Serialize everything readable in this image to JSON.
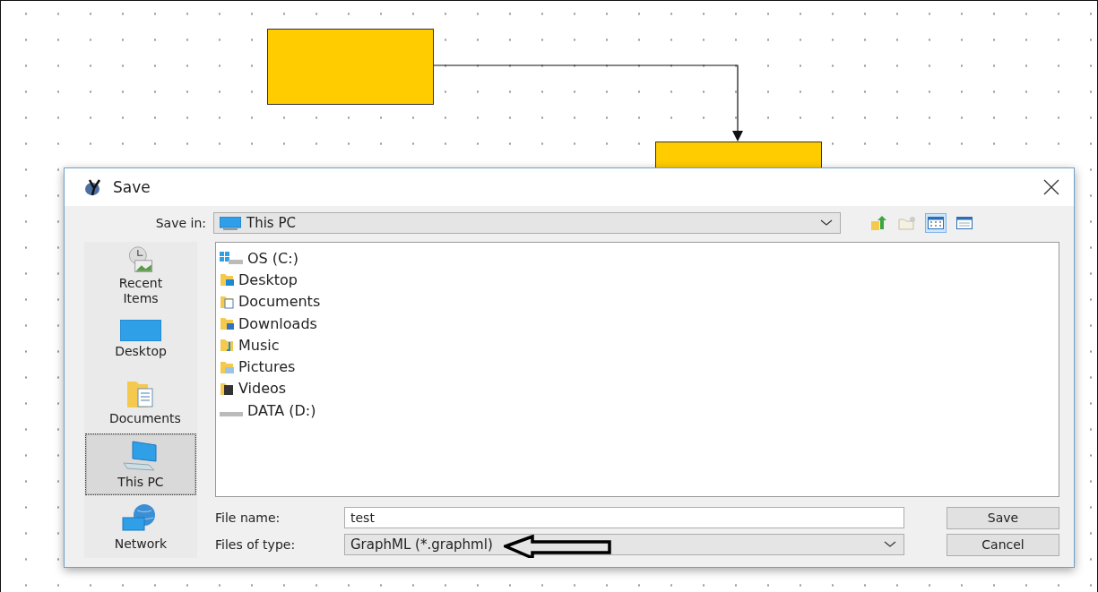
{
  "dialog": {
    "title": "Save",
    "save_in": {
      "label": "Save in:",
      "value": "This PC"
    },
    "view_buttons": [
      {
        "kind": "list",
        "selected": true
      },
      {
        "kind": "details",
        "selected": false
      }
    ],
    "places": [
      {
        "label": "Recent Items",
        "kind": "recent",
        "selected": false
      },
      {
        "label": "Desktop",
        "kind": "desktop",
        "selected": false
      },
      {
        "label": "Documents",
        "kind": "documents",
        "selected": false
      },
      {
        "label": "This PC",
        "kind": "pc",
        "selected": true
      },
      {
        "label": "Network",
        "kind": "network",
        "selected": false
      }
    ],
    "files": [
      {
        "name": "OS (C:)",
        "kind": "drive"
      },
      {
        "name": "Desktop",
        "kind": "desktop"
      },
      {
        "name": "Documents",
        "kind": "documents"
      },
      {
        "name": "Downloads",
        "kind": "downloads"
      },
      {
        "name": "Music",
        "kind": "music"
      },
      {
        "name": "Pictures",
        "kind": "pictures"
      },
      {
        "name": "Videos",
        "kind": "videos"
      },
      {
        "name": "DATA (D:)",
        "kind": "disk"
      }
    ],
    "file_name": {
      "label": "File name:",
      "value": "test"
    },
    "file_type": {
      "label": "Files of type:",
      "value": "GraphML (*.graphml)"
    },
    "buttons": [
      "Save",
      "Cancel"
    ]
  }
}
